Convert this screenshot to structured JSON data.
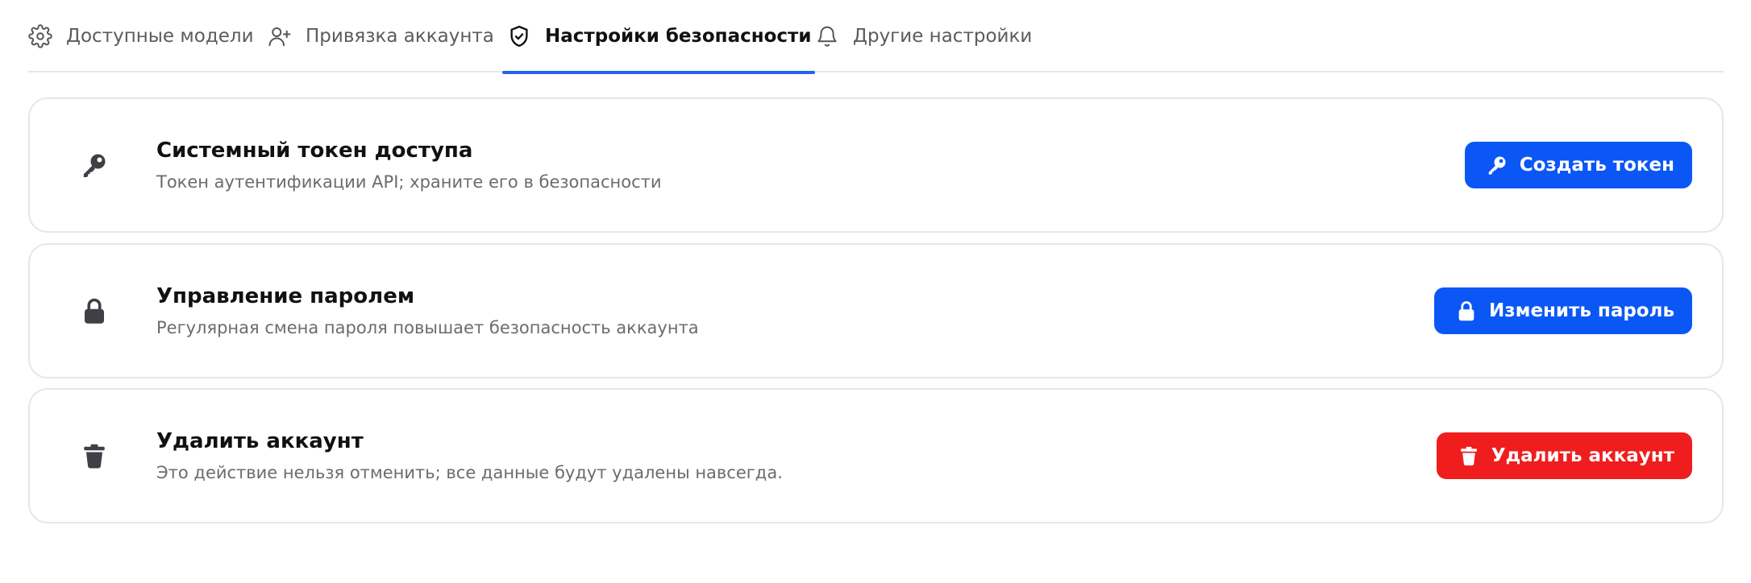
{
  "tabs": [
    {
      "label": "Доступные модели",
      "icon": "gear-icon",
      "active": false
    },
    {
      "label": "Привязка аккаунта",
      "icon": "user-plus-icon",
      "active": false
    },
    {
      "label": "Настройки безопасности",
      "icon": "shield-check-icon",
      "active": true
    },
    {
      "label": "Другие настройки",
      "icon": "bell-icon",
      "active": false
    }
  ],
  "cards": {
    "token": {
      "icon": "key-icon",
      "title": "Системный токен доступа",
      "description": "Токен аутентификации API; храните его в безопасности",
      "button_label": "Создать токен",
      "button_icon": "key-icon"
    },
    "password": {
      "icon": "lock-icon",
      "title": "Управление паролем",
      "description": "Регулярная смена пароля повышает безопасность аккаунта",
      "button_label": "Изменить пароль",
      "button_icon": "lock-icon"
    },
    "delete": {
      "icon": "trash-icon",
      "title": "Удалить аккаунт",
      "description": "Это действие нельзя отменить; все данные будут удалены навсегда.",
      "button_label": "Удалить аккаунт",
      "button_icon": "trash-icon"
    }
  },
  "colors": {
    "accent": "#0b57f5",
    "active_tab_underline": "#2563eb",
    "danger": "#ef1d1d",
    "border": "#e7e7ea",
    "icon": "#3f3f46"
  }
}
